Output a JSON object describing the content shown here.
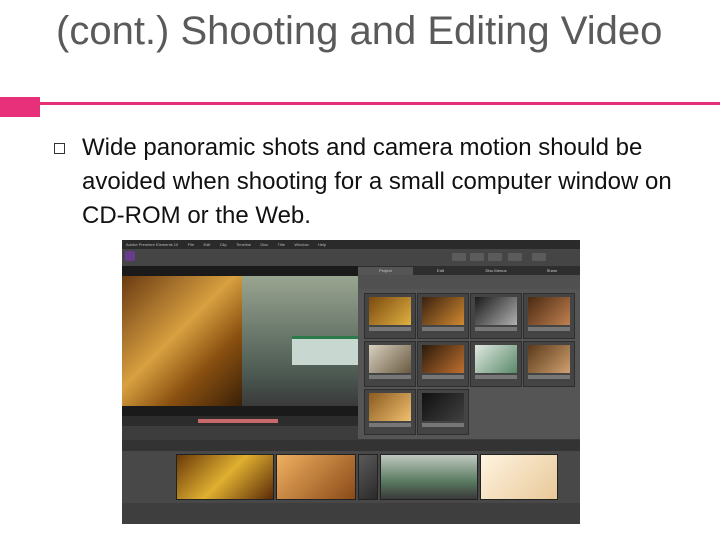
{
  "slide": {
    "title": "(cont.) Shooting and Editing Video",
    "bullet": "Wide panoramic shots and camera motion should be avoided when shooting for a small computer window on CD-ROM or the Web."
  },
  "colors": {
    "accent": "#e8307a",
    "title": "#5a5a5a"
  },
  "app": {
    "menu": [
      "Adobe Premiere Elements 10",
      "File",
      "Edit",
      "Clip",
      "Timeline",
      "Disc",
      "Title",
      "Window",
      "Help"
    ],
    "tabs": [
      "Project",
      "Edit",
      "Disc Menus",
      "Share"
    ]
  }
}
